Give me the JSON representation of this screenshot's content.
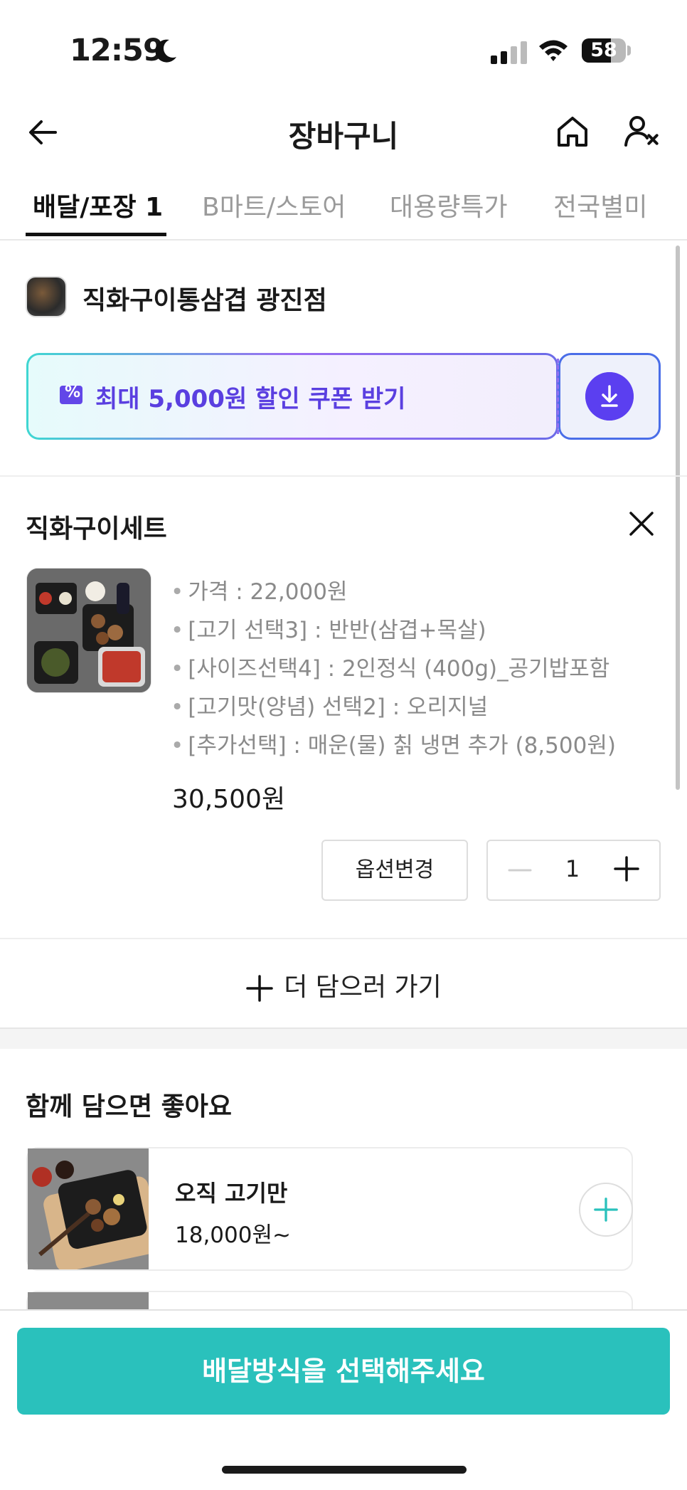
{
  "status_bar": {
    "time": "12:59",
    "battery": "58"
  },
  "header": {
    "title": "장바구니"
  },
  "tabs": [
    {
      "label": "배달/포장 1"
    },
    {
      "label": "B마트/스토어"
    },
    {
      "label": "대용량특가"
    },
    {
      "label": "전국별미"
    }
  ],
  "store": {
    "name": "직화구이통삼겹 광진점"
  },
  "coupon": {
    "label": "최대 5,000원 할인 쿠폰 받기"
  },
  "item": {
    "name": "직화구이세트",
    "options": [
      "가격 : 22,000원",
      "[고기 선택3] : 반반(삼겹+목살)",
      "[사이즈선택4] : 2인정식 (400g)_공기밥포함",
      "[고기맛(양념) 선택2] : 오리지널",
      "[추가선택] : 매운(물) 칡 냉면 추가 (8,500원)"
    ],
    "price": "30,500원",
    "change_option_label": "옵션변경",
    "quantity": "1"
  },
  "add_more": {
    "label": "더 담으러 가기"
  },
  "recommend": {
    "title": "함께 담으면 좋아요",
    "items": [
      {
        "name": "오직 고기만",
        "price": "18,000원~"
      }
    ]
  },
  "cta": {
    "label": "배달방식을 선택해주세요"
  },
  "colors": {
    "brand": "#2ac1bc",
    "coupon_accent": "#5b3ff0"
  },
  "icons": [
    "moon-icon",
    "signal-icon",
    "wifi-icon",
    "battery-icon",
    "back-icon",
    "home-icon",
    "user-icon",
    "coupon-icon",
    "download-icon",
    "close-icon",
    "minus-icon",
    "plus-icon"
  ]
}
